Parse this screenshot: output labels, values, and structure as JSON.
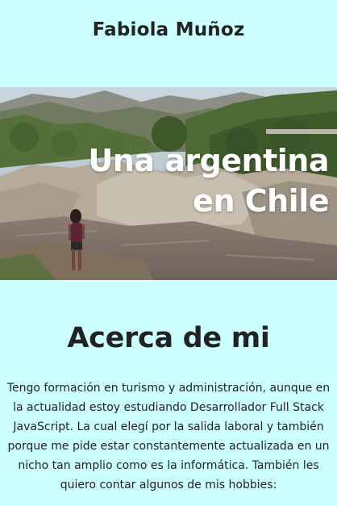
{
  "header": {
    "title": "Fabiola Muñoz"
  },
  "hero": {
    "line1": "Una argentina",
    "line2": "en Chile",
    "image": "photo-woman-standing-on-rocks-by-mountain-river"
  },
  "about": {
    "title": "Acerca de mi",
    "text": "Tengo formación en turismo y administración, aunque en la actualidad estoy estudiando Desarrollador Full Stack JavaScript. La cual elegí por la salida laboral y también porque me pide estar constantemente actualizada en un nicho tan amplio como es la informática. También les quiero contar algunos de mis hobbies:"
  },
  "colors": {
    "background": "#ccffff",
    "text": "#222222",
    "hero_text": "#ffffff"
  }
}
